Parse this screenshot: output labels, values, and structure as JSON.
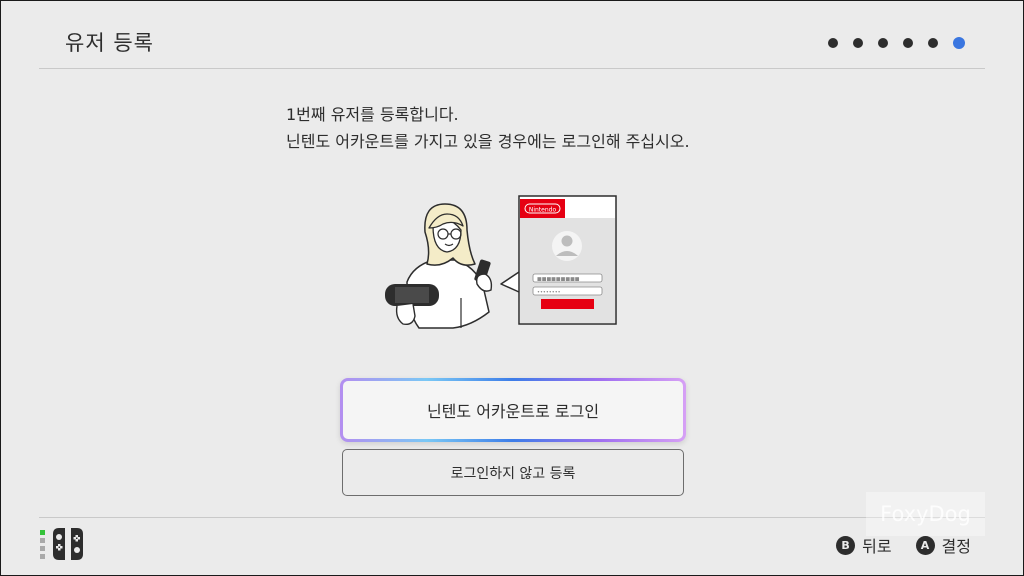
{
  "header": {
    "title": "유저 등록",
    "progress": {
      "total_steps": 6,
      "current_step": 6
    }
  },
  "intro": {
    "line1": "1번째 유저를 등록합니다.",
    "line2": "닌텐도 어카운트를 가지고 있을 경우에는 로그인해 주십시오."
  },
  "illustration": {
    "brand_badge": "Nintendo",
    "username_mask": "■■■■■■■■■",
    "password_mask": "••••••••"
  },
  "buttons": {
    "login_label": "닌텐도 어카운트로 로그인",
    "skip_label": "로그인하지 않고 등록"
  },
  "footer": {
    "back": {
      "glyph": "B",
      "label": "뒤로"
    },
    "confirm": {
      "glyph": "A",
      "label": "결정"
    },
    "player_indicator": {
      "lit": 1,
      "total": 4
    }
  },
  "watermark": "FoxyDog",
  "colors": {
    "background": "#ebebeb",
    "text": "#2d2d2d",
    "accent_dot": "#3a76e0",
    "nintendo_red": "#e60012",
    "player_led": "#35c33a"
  }
}
